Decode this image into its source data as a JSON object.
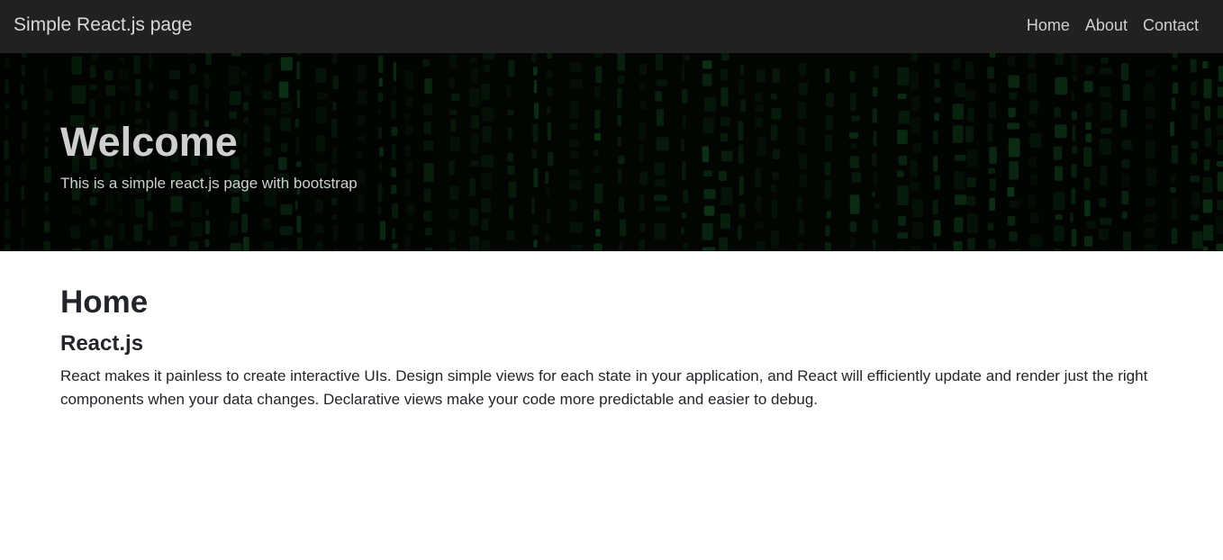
{
  "navbar": {
    "brand": "Simple React.js page",
    "links": [
      "Home",
      "About",
      "Contact"
    ]
  },
  "hero": {
    "title": "Welcome",
    "subtitle": "This is a simple react.js page with bootstrap"
  },
  "main": {
    "title": "Home",
    "subtitle": "React.js",
    "paragraph": "React makes it painless to create interactive UIs. Design simple views for each state in your application, and React will efficiently update and render just the right components when your data changes. Declarative views make your code more predictable and easier to debug."
  },
  "colors": {
    "navbar_bg": "#212121",
    "hero_bg": "#020502",
    "matrix_green": "#1f8a3a",
    "text_dark": "#222529"
  }
}
